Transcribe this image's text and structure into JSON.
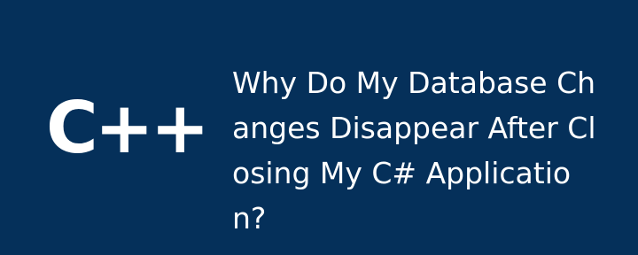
{
  "theme": {
    "background": "#05305A",
    "text_color": "#FFFFFF"
  },
  "logo": {
    "text": "C++"
  },
  "title": "Why Do My Database Changes Disappear After Closing My C# Application?"
}
